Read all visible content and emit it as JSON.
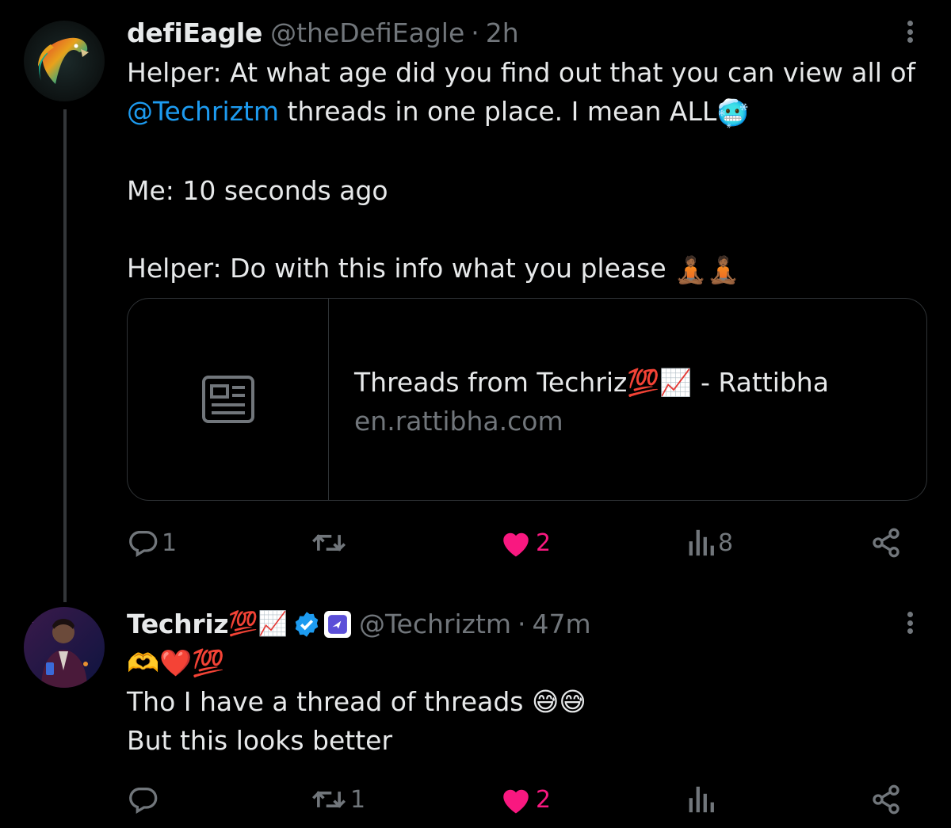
{
  "tweet1": {
    "display_name": "defiEagle",
    "handle": "@theDefiEagle",
    "separator": "·",
    "time": "2h",
    "line1": "Helper: At what age did you find out that you can view all of",
    "mention": "@Techriztm",
    "line2_rest": " threads in one place. I mean ALL",
    "line2_emoji": "🥶",
    "line3": "Me: 10 seconds ago",
    "line4": "Helper: Do with this info what you please ",
    "line4_emoji": "🧘🏾🧘🏾",
    "card": {
      "title": "Threads from Techriz💯📈 - Rattibha",
      "domain": "en.rattibha.com",
      "thumb_icon": "article-icon"
    },
    "actions": {
      "replies": "1",
      "retweets": "",
      "likes": "2",
      "views": "8"
    }
  },
  "tweet2": {
    "display_name_text": "Techriz",
    "display_name_emoji": "💯📈",
    "handle": "@Techriztm",
    "separator": "·",
    "time": "47m",
    "line1": "🫶❤️💯",
    "line2": "Tho I have a thread of threads 😅😅",
    "line3": "But this looks better",
    "actions": {
      "replies": "",
      "retweets": "1",
      "likes": "2",
      "views": ""
    }
  },
  "colors": {
    "background": "#000000",
    "text": "#e7e9ea",
    "muted": "#71767b",
    "link": "#1d9bf0",
    "like": "#f91880",
    "verified": "#1d9bf0"
  }
}
